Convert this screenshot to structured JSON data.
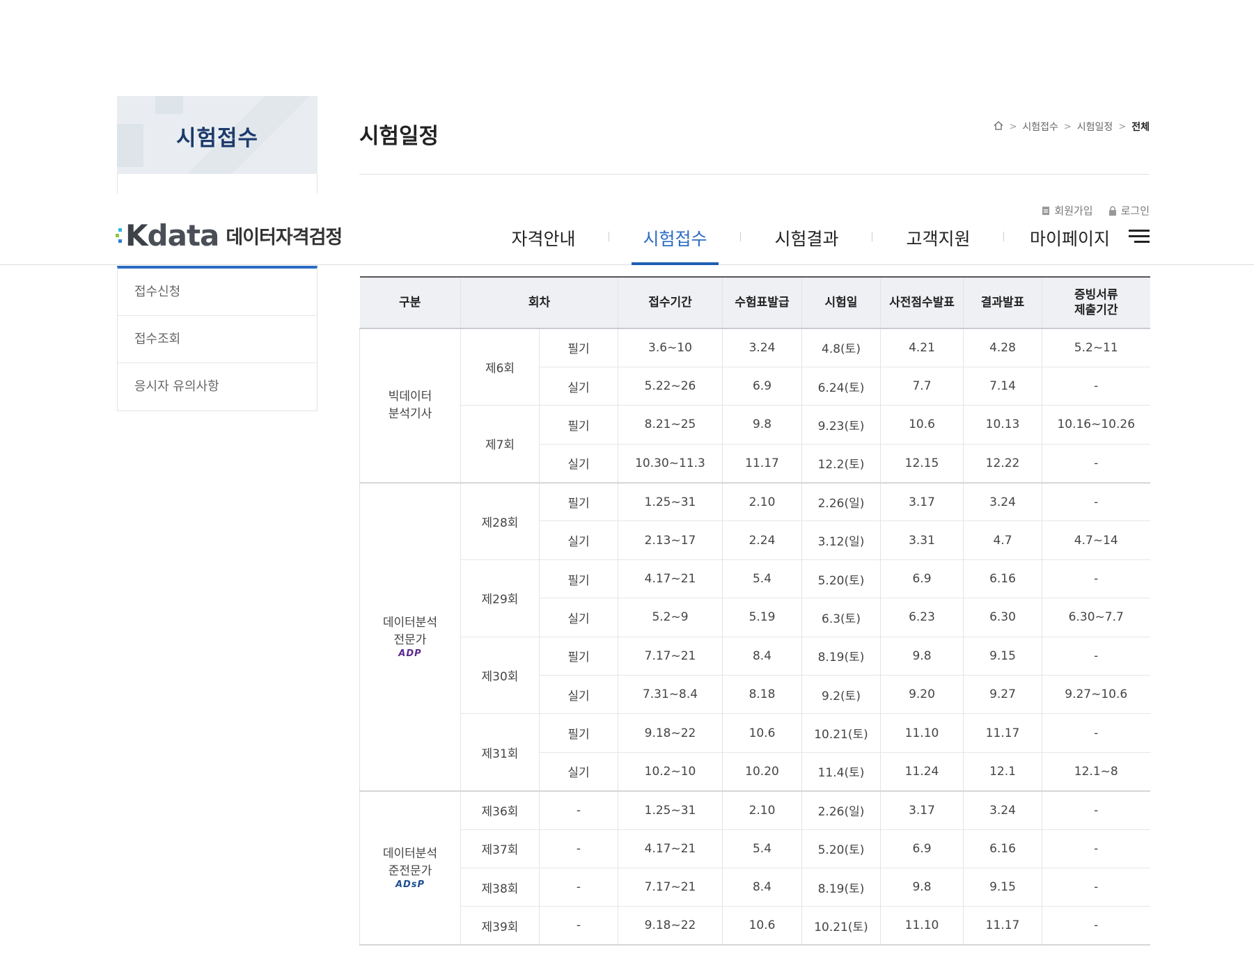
{
  "sidebar": {
    "banner_title": "시험접수",
    "menu": [
      {
        "label": "접수신청"
      },
      {
        "label": "접수조회"
      },
      {
        "label": "응시자 유의사항"
      }
    ]
  },
  "page": {
    "title": "시험일정",
    "breadcrumb": [
      "시험접수",
      "시험일정",
      "전체"
    ]
  },
  "header": {
    "logo_text": "data",
    "logo_sub": "데이터자격검정",
    "util": {
      "join": "회원가입",
      "login": "로그인"
    },
    "nav": [
      "자격안내",
      "시험접수",
      "시험결과",
      "고객지원",
      "마이페이지"
    ],
    "active_nav": "시험접수",
    "colors": {
      "accent": "#2b6cc4",
      "brand_navy": "#1c3a6b"
    }
  },
  "table": {
    "headers": [
      "구분",
      "회차",
      "접수기간",
      "수험표발급",
      "시험일",
      "사전점수발표",
      "결과발표",
      "증빙서류\n제출기간"
    ],
    "groups": [
      {
        "category": "빅데이터\n분석기사",
        "category_logo": "",
        "rounds": [
          {
            "round": "제6회",
            "rows": [
              {
                "type": "필기",
                "period": "3.6~10",
                "ticket": "3.24",
                "exam": "4.8(토)",
                "pre": "4.21",
                "result": "4.28",
                "docs": "5.2~11"
              },
              {
                "type": "실기",
                "period": "5.22~26",
                "ticket": "6.9",
                "exam": "6.24(토)",
                "pre": "7.7",
                "result": "7.14",
                "docs": "-"
              }
            ]
          },
          {
            "round": "제7회",
            "rows": [
              {
                "type": "필기",
                "period": "8.21~25",
                "ticket": "9.8",
                "exam": "9.23(토)",
                "pre": "10.6",
                "result": "10.13",
                "docs": "10.16~10.26"
              },
              {
                "type": "실기",
                "period": "10.30~11.3",
                "ticket": "11.17",
                "exam": "12.2(토)",
                "pre": "12.15",
                "result": "12.22",
                "docs": "-"
              }
            ]
          }
        ]
      },
      {
        "category": "데이터분석\n전문가",
        "category_logo": "ADP",
        "rounds": [
          {
            "round": "제28회",
            "rows": [
              {
                "type": "필기",
                "period": "1.25~31",
                "ticket": "2.10",
                "exam": "2.26(일)",
                "pre": "3.17",
                "result": "3.24",
                "docs": "-"
              },
              {
                "type": "실기",
                "period": "2.13~17",
                "ticket": "2.24",
                "exam": "3.12(일)",
                "pre": "3.31",
                "result": "4.7",
                "docs": "4.7~14"
              }
            ]
          },
          {
            "round": "제29회",
            "rows": [
              {
                "type": "필기",
                "period": "4.17~21",
                "ticket": "5.4",
                "exam": "5.20(토)",
                "pre": "6.9",
                "result": "6.16",
                "docs": "-"
              },
              {
                "type": "실기",
                "period": "5.2~9",
                "ticket": "5.19",
                "exam": "6.3(토)",
                "pre": "6.23",
                "result": "6.30",
                "docs": "6.30~7.7"
              }
            ]
          },
          {
            "round": "제30회",
            "rows": [
              {
                "type": "필기",
                "period": "7.17~21",
                "ticket": "8.4",
                "exam": "8.19(토)",
                "pre": "9.8",
                "result": "9.15",
                "docs": "-"
              },
              {
                "type": "실기",
                "period": "7.31~8.4",
                "ticket": "8.18",
                "exam": "9.2(토)",
                "pre": "9.20",
                "result": "9.27",
                "docs": "9.27~10.6"
              }
            ]
          },
          {
            "round": "제31회",
            "rows": [
              {
                "type": "필기",
                "period": "9.18~22",
                "ticket": "10.6",
                "exam": "10.21(토)",
                "pre": "11.10",
                "result": "11.17",
                "docs": "-"
              },
              {
                "type": "실기",
                "period": "10.2~10",
                "ticket": "10.20",
                "exam": "11.4(토)",
                "pre": "11.24",
                "result": "12.1",
                "docs": "12.1~8"
              }
            ]
          }
        ]
      },
      {
        "category": "데이터분석\n준전문가",
        "category_logo": "ADsP",
        "rounds": [
          {
            "round": "제36회",
            "rows": [
              {
                "type": "-",
                "period": "1.25~31",
                "ticket": "2.10",
                "exam": "2.26(일)",
                "pre": "3.17",
                "result": "3.24",
                "docs": "-"
              }
            ]
          },
          {
            "round": "제37회",
            "rows": [
              {
                "type": "-",
                "period": "4.17~21",
                "ticket": "5.4",
                "exam": "5.20(토)",
                "pre": "6.9",
                "result": "6.16",
                "docs": "-"
              }
            ]
          },
          {
            "round": "제38회",
            "rows": [
              {
                "type": "-",
                "period": "7.17~21",
                "ticket": "8.4",
                "exam": "8.19(토)",
                "pre": "9.8",
                "result": "9.15",
                "docs": "-"
              }
            ]
          },
          {
            "round": "제39회",
            "rows": [
              {
                "type": "-",
                "period": "9.18~22",
                "ticket": "10.6",
                "exam": "10.21(토)",
                "pre": "11.10",
                "result": "11.17",
                "docs": "-"
              }
            ]
          }
        ]
      }
    ]
  }
}
